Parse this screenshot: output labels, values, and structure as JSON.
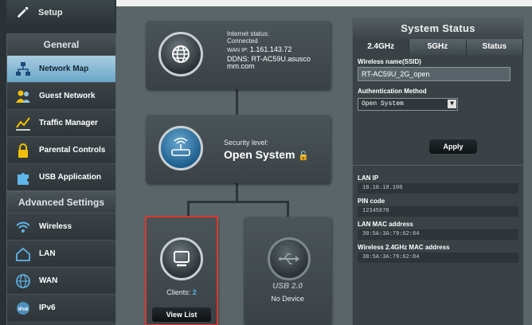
{
  "sidebar": {
    "setup_label": "Setup",
    "general_title": "General",
    "items": [
      {
        "label": "Network Map"
      },
      {
        "label": "Guest Network"
      },
      {
        "label": "Traffic Manager"
      },
      {
        "label": "Parental Controls"
      },
      {
        "label": "USB Application"
      }
    ],
    "advanced_title": "Advanced Settings",
    "advanced_items": [
      {
        "label": "Wireless"
      },
      {
        "label": "LAN"
      },
      {
        "label": "WAN"
      },
      {
        "label": "IPv6"
      }
    ]
  },
  "internet": {
    "status_label": "Internet status:",
    "status_value": "Connected",
    "wan_ip_label": "WAN IP:",
    "wan_ip_value": "1.161.143.72",
    "ddns_line1": "DDNS: RT-AC59U.asusco",
    "ddns_line2": "mm.com"
  },
  "security": {
    "label": "Security level:",
    "value": "Open System"
  },
  "clients": {
    "label": "Clients:",
    "count": "2",
    "button": "View List"
  },
  "usb": {
    "label": "USB 2.0",
    "status": "No Device"
  },
  "status_panel": {
    "title": "System Status",
    "tabs": [
      "2.4GHz",
      "5GHz",
      "Status"
    ],
    "ssid_label": "Wireless name(SSID)",
    "ssid_value": "RT-AC59U_2G_open",
    "auth_label": "Authentication Method",
    "auth_value": "Open System",
    "apply_label": "Apply",
    "lan_ip_label": "LAN IP",
    "lan_ip_value": "10.10.10.100",
    "pin_label": "PIN code",
    "pin_value": "12345670",
    "lan_mac_label": "LAN MAC address",
    "lan_mac_value": "30:5A:3A:79:62:84",
    "wl_mac_label": "Wireless 2.4GHz MAC address",
    "wl_mac_value": "30:5A:3A:79:62:84"
  },
  "colors": {
    "accent_active": "#6aa6c8",
    "highlight_border": "#d9382e",
    "clients_count": "#5fb6e8"
  }
}
